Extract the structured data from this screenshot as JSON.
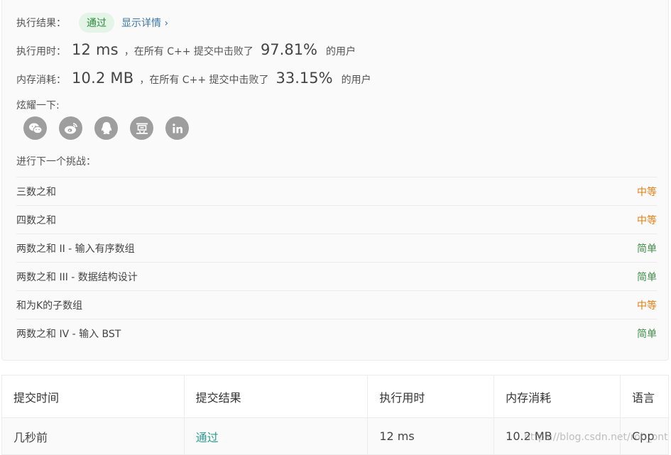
{
  "result": {
    "label": "执行结果：",
    "status": "通过",
    "detail_link": "显示详情 ›"
  },
  "runtime": {
    "label": "执行用时：",
    "value": "12 ms",
    "middle": "，在所有 C++ 提交中击败了",
    "percent": "97.81%",
    "suffix": "的用户"
  },
  "memory": {
    "label": "内存消耗：",
    "value": "10.2 MB",
    "middle": "，在所有 C++ 提交中击败了",
    "percent": "33.15%",
    "suffix": "的用户"
  },
  "share": {
    "label": "炫耀一下:",
    "icons": [
      "wechat-icon",
      "weibo-icon",
      "qq-icon",
      "douban-icon",
      "linkedin-icon"
    ]
  },
  "next_challenge": {
    "label": "进行下一个挑战：",
    "items": [
      {
        "title": "三数之和",
        "difficulty": "中等"
      },
      {
        "title": "四数之和",
        "difficulty": "中等"
      },
      {
        "title": "两数之和 II - 输入有序数组",
        "difficulty": "简单"
      },
      {
        "title": "两数之和 III - 数据结构设计",
        "difficulty": "简单"
      },
      {
        "title": "和为K的子数组",
        "difficulty": "中等"
      },
      {
        "title": "两数之和 IV - 输入 BST",
        "difficulty": "简单"
      }
    ]
  },
  "table": {
    "headers": [
      "提交时间",
      "提交结果",
      "执行用时",
      "内存消耗",
      "语言"
    ],
    "rows": [
      [
        "几秒前",
        "通过",
        "12 ms",
        "10.2 MB",
        "Cpp"
      ]
    ]
  },
  "watermark": "https://blog.csdn.net/roh_ont",
  "colors": {
    "medium": "#e27d12",
    "easy": "#3f8f49",
    "pass_link": "#2a9d8f",
    "badge_bg": "#e4f4e6"
  }
}
